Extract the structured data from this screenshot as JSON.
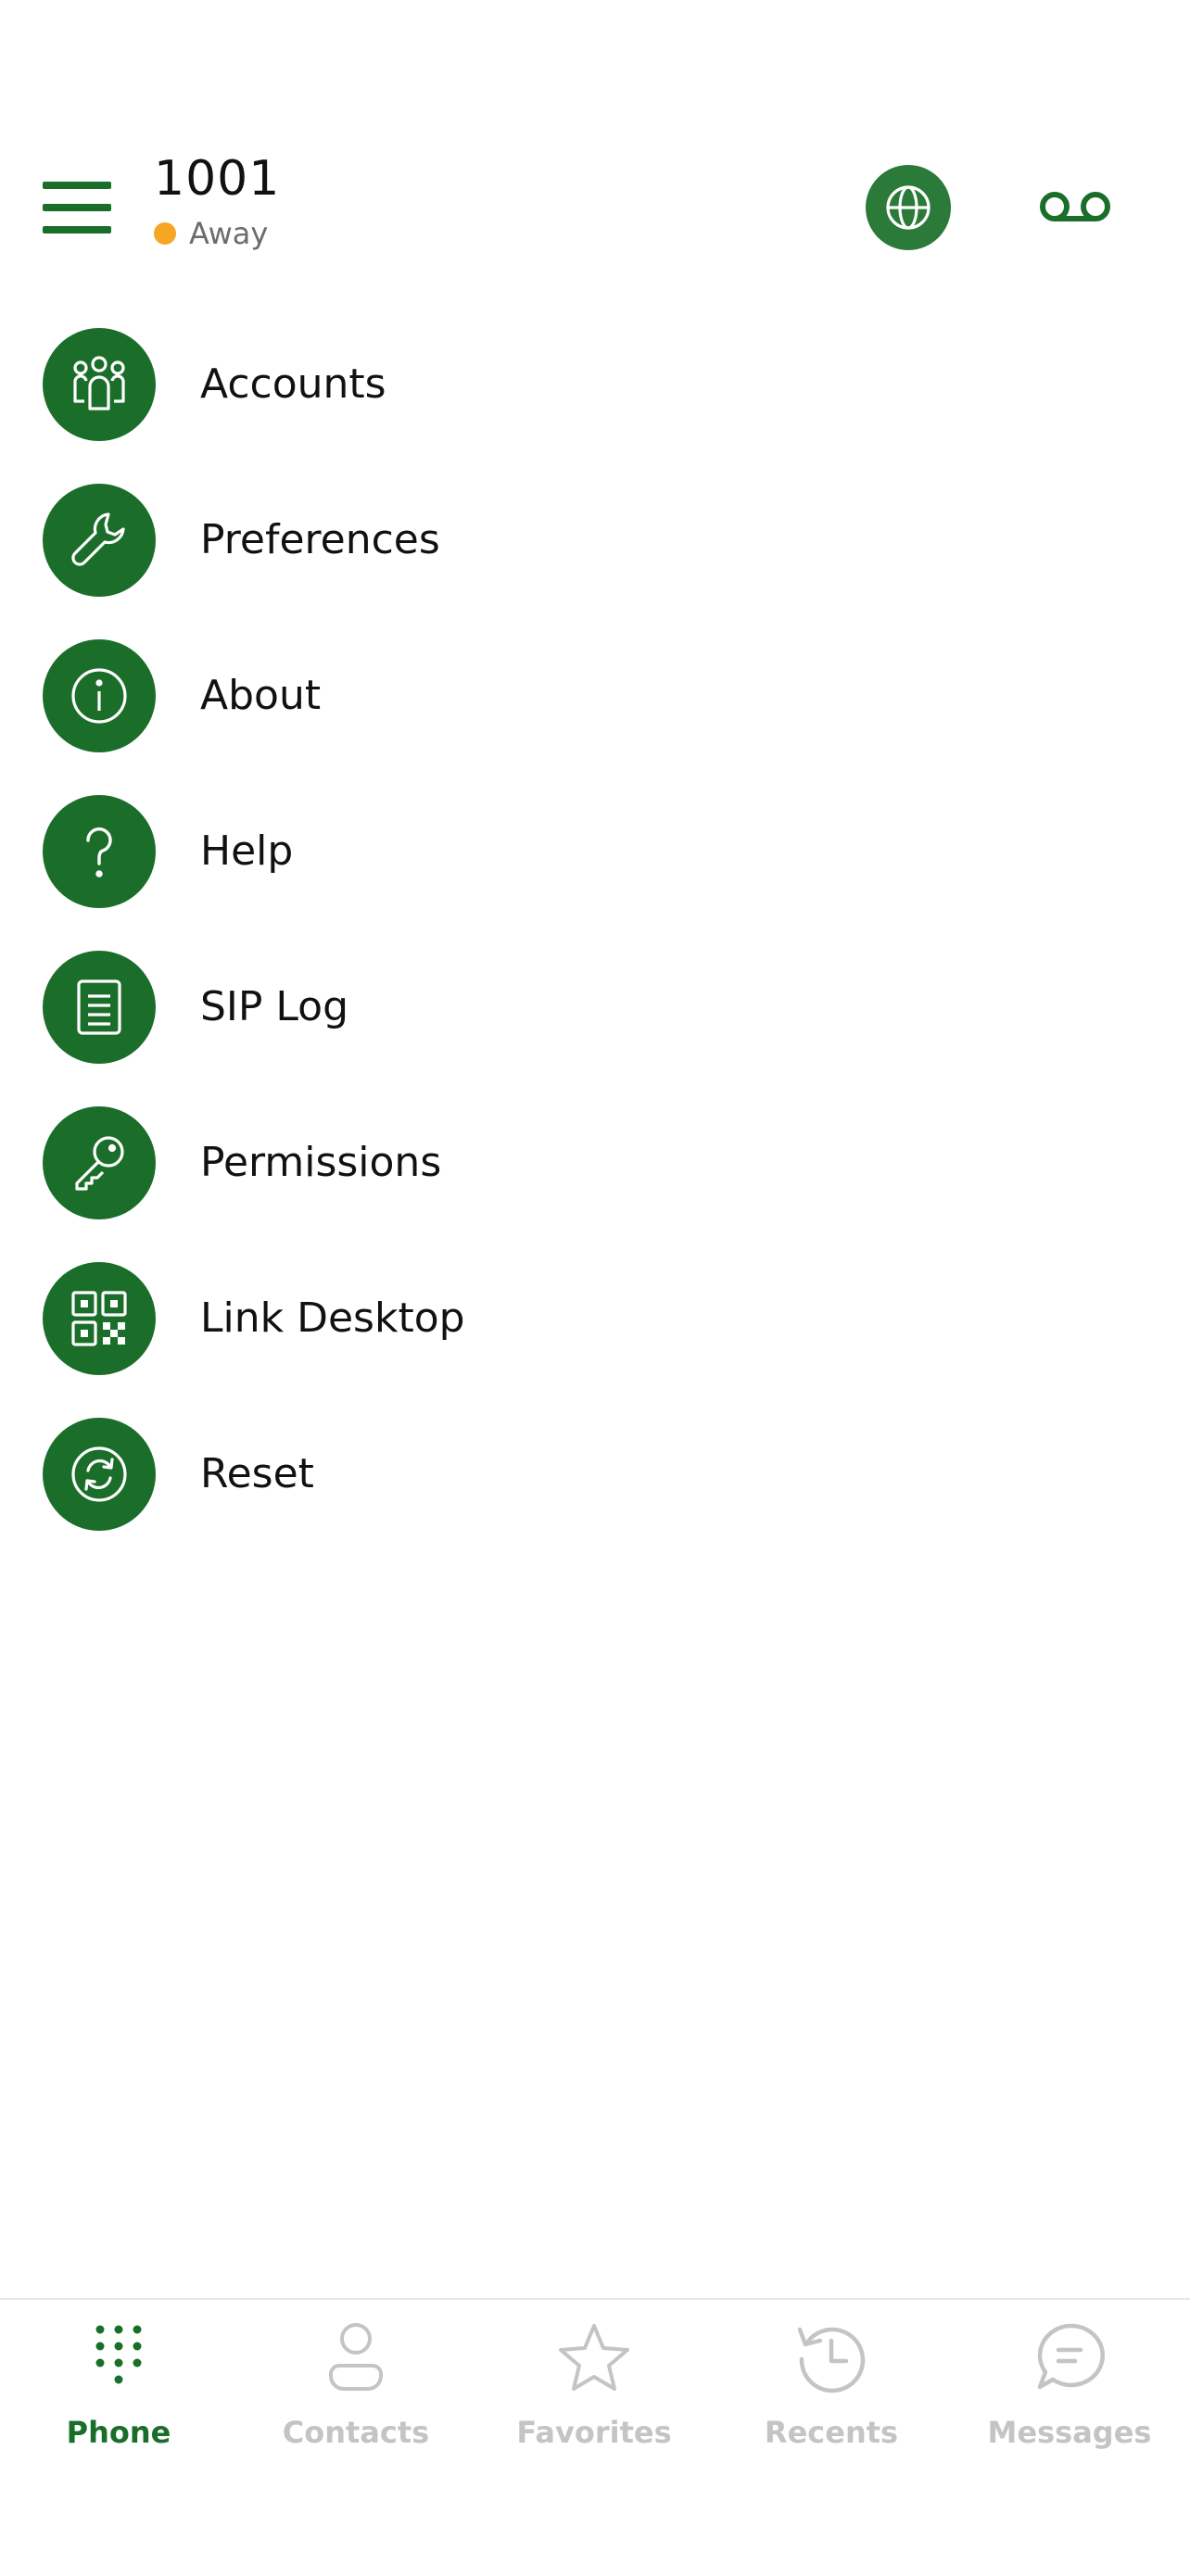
{
  "header": {
    "title": "1001",
    "status": "Away",
    "status_color": "#f5a623",
    "left_icon": "hamburger-menu-icon",
    "right_icons": [
      "globe-icon",
      "voicemail-icon"
    ]
  },
  "menu": {
    "items": [
      {
        "label": "Accounts",
        "icon": "people-group-icon"
      },
      {
        "label": "Preferences",
        "icon": "wrench-icon"
      },
      {
        "label": "About",
        "icon": "info-icon"
      },
      {
        "label": "Help",
        "icon": "question-icon"
      },
      {
        "label": "SIP Log",
        "icon": "document-icon"
      },
      {
        "label": "Permissions",
        "icon": "key-icon"
      },
      {
        "label": "Link Desktop",
        "icon": "qr-code-icon"
      },
      {
        "label": "Reset",
        "icon": "refresh-icon"
      }
    ]
  },
  "tabbar": {
    "active": "Phone",
    "tabs": [
      {
        "label": "Phone",
        "icon": "dialpad-icon"
      },
      {
        "label": "Contacts",
        "icon": "person-icon"
      },
      {
        "label": "Favorites",
        "icon": "star-icon"
      },
      {
        "label": "Recents",
        "icon": "history-clock-icon"
      },
      {
        "label": "Messages",
        "icon": "chat-bubble-icon"
      }
    ]
  },
  "colors": {
    "accent": "#1b6e2a",
    "globe_button": "#2c7a3a",
    "inactive_tab": "#c4c4c4",
    "status_away": "#f5a623"
  }
}
